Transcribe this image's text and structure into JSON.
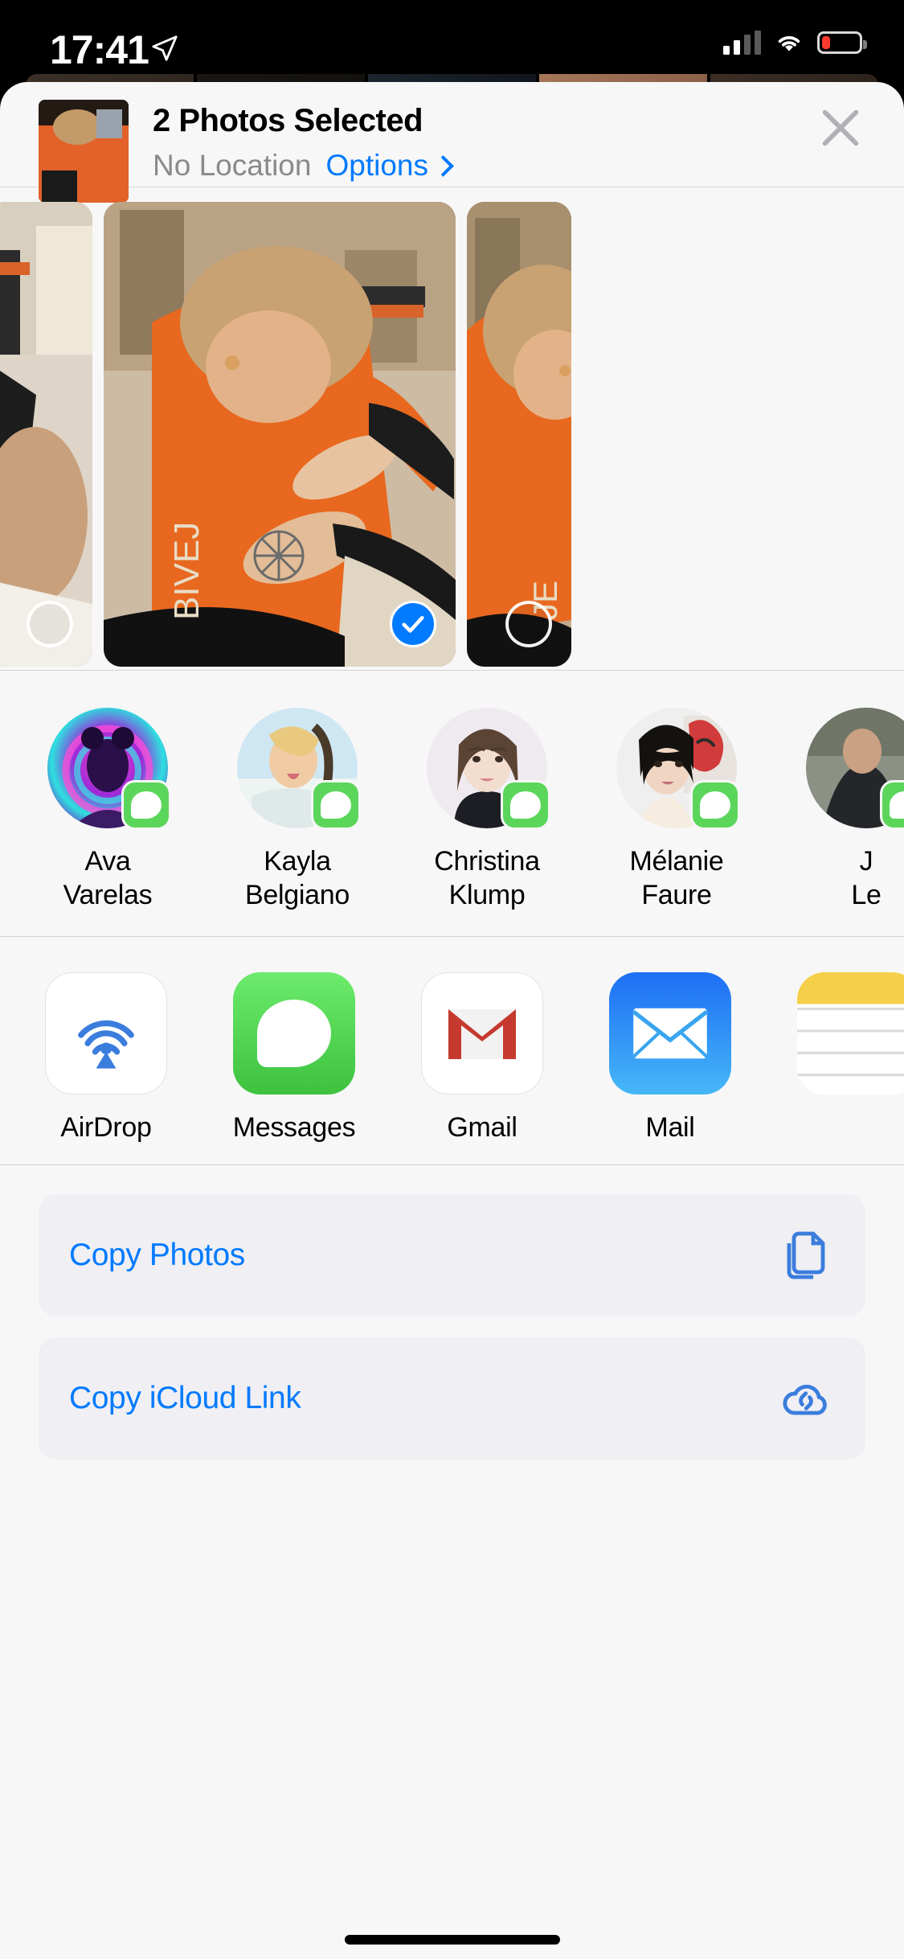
{
  "status_bar": {
    "time": "17:41",
    "location_icon": "location-arrow-icon",
    "signal_icon": "cellular-bars-icon",
    "wifi_icon": "wifi-icon",
    "battery_icon": "battery-low-icon"
  },
  "header": {
    "thumbnail_icon": "photo-thumbnail",
    "title": "2 Photos Selected",
    "location": "No Location",
    "options_label": "Options",
    "options_chevron_icon": "chevron-right-icon",
    "close_icon": "close-icon"
  },
  "carousel": {
    "photos": [
      {
        "name": "photo-previous",
        "selected": false,
        "badge_icon": "circle-unselected-icon"
      },
      {
        "name": "photo-current",
        "selected": true,
        "badge_icon": "checkmark-circle-icon"
      },
      {
        "name": "photo-next",
        "selected": false,
        "badge_icon": "circle-unselected-icon"
      }
    ]
  },
  "contacts": {
    "items": [
      {
        "first": "Ava",
        "last": "Varelas",
        "badge_icon": "messages-badge-icon",
        "avatar": "avatar-ava"
      },
      {
        "first": "Kayla",
        "last": "Belgiano",
        "badge_icon": "messages-badge-icon",
        "avatar": "avatar-kayla"
      },
      {
        "first": "Christina",
        "last": "Klump",
        "badge_icon": "messages-badge-icon",
        "avatar": "avatar-christina"
      },
      {
        "first": "Mélanie",
        "last": "Faure",
        "badge_icon": "messages-badge-icon",
        "avatar": "avatar-melanie"
      },
      {
        "first": "J",
        "last": "Le",
        "badge_icon": "messages-badge-icon",
        "avatar": "avatar-partial"
      }
    ]
  },
  "apps": {
    "items": [
      {
        "label": "AirDrop",
        "icon": "airdrop-icon"
      },
      {
        "label": "Messages",
        "icon": "messages-icon"
      },
      {
        "label": "Gmail",
        "icon": "gmail-icon"
      },
      {
        "label": "Mail",
        "icon": "mail-icon"
      },
      {
        "label": "",
        "icon": "notes-icon"
      }
    ]
  },
  "actions": {
    "items": [
      {
        "label": "Copy Photos",
        "icon": "copy-documents-icon"
      },
      {
        "label": "Copy iCloud Link",
        "icon": "icloud-link-icon"
      }
    ]
  },
  "colors": {
    "accent_blue": "#007aff",
    "sheet_bg": "#f7f7f7",
    "row_bg": "#efeff4",
    "messages_green": "#5bd65b",
    "battery_red": "#ff3b30",
    "secondary_text": "#8a8a8e"
  }
}
